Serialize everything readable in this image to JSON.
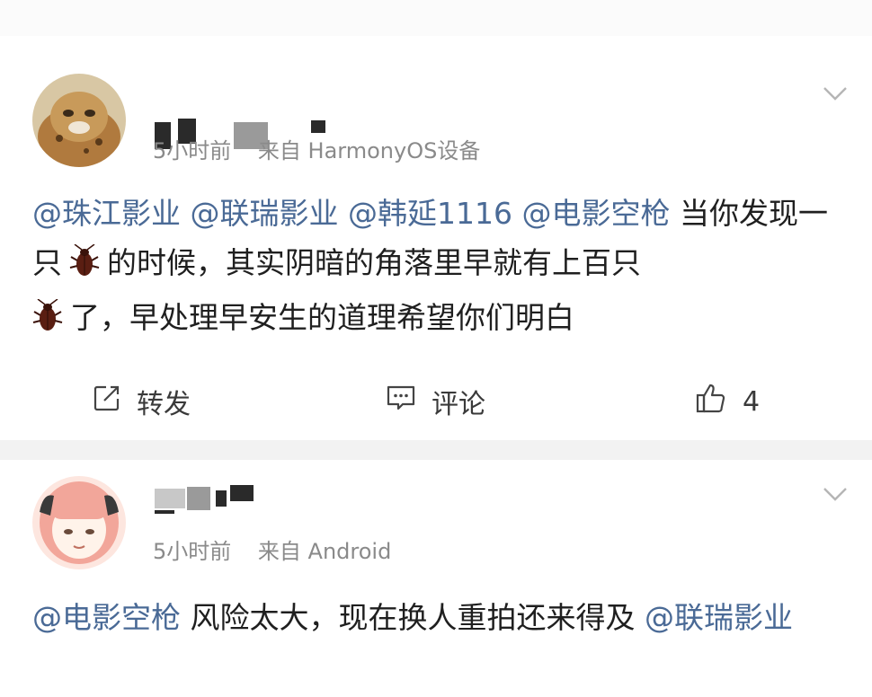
{
  "posts": [
    {
      "username_visible": "",
      "time": "5小时前",
      "source": "来自 HarmonyOS设备",
      "content": {
        "mentions": [
          "@珠江影业",
          "@联瑞影业",
          "@韩延1116",
          "@电影空枪"
        ],
        "text1": "当你发现一只",
        "text2": "的时候，其实阴暗的角落里早就有上百只",
        "text3": "了，早处理早安生的道理希望你们明白"
      },
      "actions": {
        "repost_label": "转发",
        "comment_label": "评论",
        "like_count": "4"
      }
    },
    {
      "username_visible": "",
      "time": "5小时前",
      "source": "来自 Android",
      "content": {
        "mention_start": "@电影空枪",
        "text": "风险太大，现在换人重拍还来得及",
        "mention_end": "@联瑞影业"
      }
    }
  ],
  "icons": {
    "repost": "repost-icon",
    "comment": "comment-icon",
    "like": "thumbs-up-icon",
    "more": "chevron-down-icon",
    "emoji": "cockroach-emoji"
  },
  "colors": {
    "mention": "#4a6a96",
    "meta": "#8a8a8a",
    "divider": "#f2f2f2"
  }
}
